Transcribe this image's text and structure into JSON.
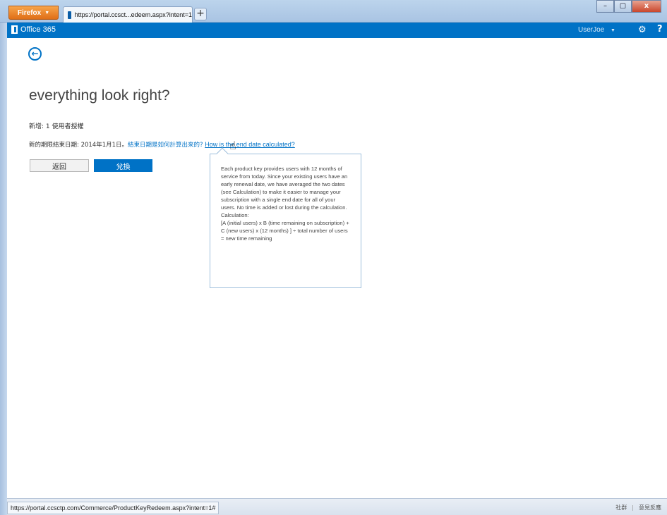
{
  "browser": {
    "menu_button": "Firefox",
    "tab_title": "https://portal.ccsct...edeem.aspx?intent=1",
    "new_tab": "+",
    "window_controls": [
      "–",
      "▢",
      "x"
    ]
  },
  "o365": {
    "logo_text": "Office 365",
    "user": "UserJoe",
    "user_caret": "▼",
    "settings_icon": "gear-icon",
    "help_icon": "?"
  },
  "main": {
    "back_icon": "←",
    "title": "everything look right?",
    "add_line": "新增: 1 使用者授權",
    "date_prefix": "新的期限結束日期: 2014年1月1日。",
    "date_link_cn": "結束日期是如何計算出來的?",
    "date_link_en": "How is the end date calculated?",
    "btn_back": "返回",
    "btn_redeem": "兌換"
  },
  "tooltip": {
    "text1": "Each product key provides users with 12 months of service from today. Since your existing users have an early renewal date, we have averaged the two dates (see Calculation) to make it easier to manage your subscription with a single end date for all of your users. No time is added or lost during the calculation.",
    "label": "Calculation:",
    "formula": "[A (initial users) x B (time remaining on subscription) + C (new users) x (12 months) ] ÷ total number of users = new time remaining"
  },
  "status": {
    "url": "https://portal.ccsctp.com/Commerce/ProductKeyRedeem.aspx?intent=1#",
    "link1": "社群",
    "sep": "|",
    "link2": "意見反應"
  },
  "colors": {
    "accent": "#0072c6"
  }
}
